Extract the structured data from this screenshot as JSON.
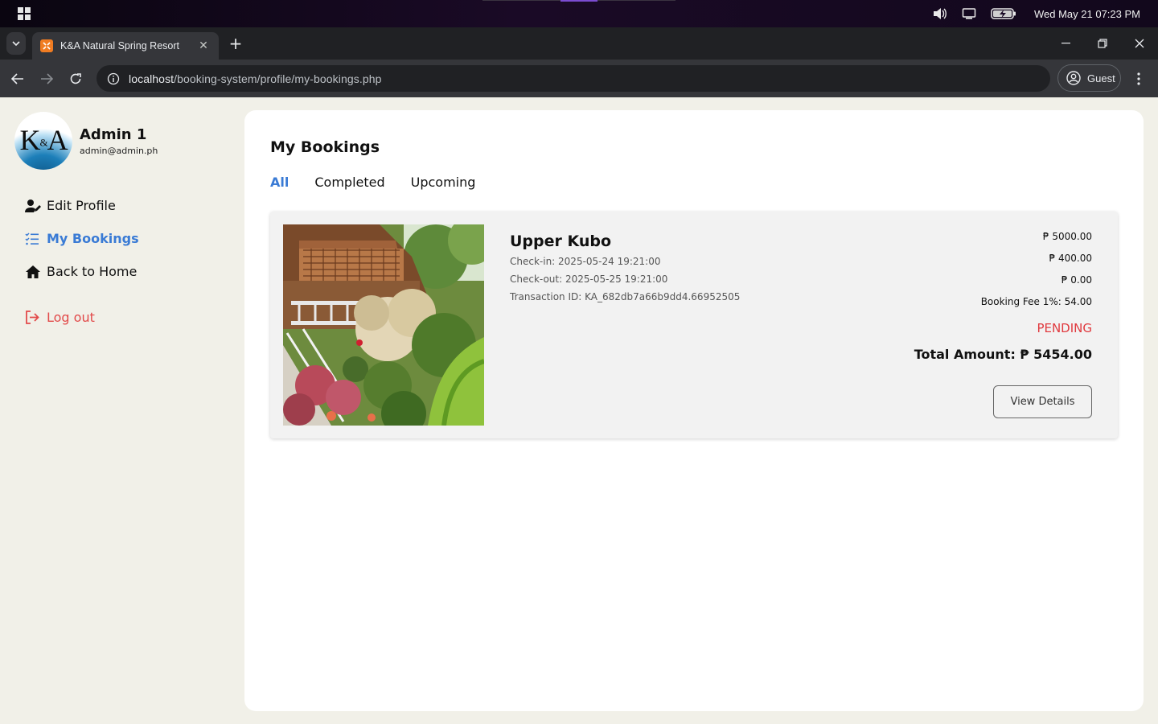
{
  "os": {
    "clock": "Wed May 21  07:23 PM",
    "icons": [
      "windows-logo-icon",
      "volume-icon",
      "display-icon",
      "battery-charging-icon"
    ]
  },
  "browser": {
    "tab_title": "K&A Natural Spring Resort",
    "url_host": "localhost",
    "url_path": "/booking-system/profile/my-bookings.php",
    "profile_label": "Guest"
  },
  "profile": {
    "logo_text": "K",
    "logo_amp": "&",
    "logo_text2": "A",
    "name": "Admin 1",
    "email": "admin@admin.ph"
  },
  "sidebar": {
    "items": [
      {
        "label": "Edit Profile",
        "icon": "user-edit-icon"
      },
      {
        "label": "My Bookings",
        "icon": "list-check-icon",
        "active": true
      },
      {
        "label": "Back to Home",
        "icon": "home-icon"
      }
    ],
    "logout": {
      "label": "Log out",
      "icon": "logout-icon"
    }
  },
  "main": {
    "title": "My Bookings",
    "tabs": [
      {
        "label": "All",
        "active": true
      },
      {
        "label": "Completed"
      },
      {
        "label": "Upcoming"
      }
    ]
  },
  "booking": {
    "room_name": "Upper Kubo",
    "check_in": "Check-in: 2025-05-24 19:21:00",
    "check_out": "Check-out: 2025-05-25 19:21:00",
    "transaction": "Transaction ID: KA_682db7a66b9dd4.66952505",
    "price_1": "₱ 5000.00",
    "price_2": "₱ 400.00",
    "price_3": "₱ 0.00",
    "booking_fee": "Booking Fee 1%: 54.00",
    "status": "PENDING",
    "total": "Total Amount: ₱ 5454.00",
    "view_details": "View Details"
  },
  "colors": {
    "accent": "#3a7bd5",
    "danger": "#e24a4a",
    "page_bg": "#f1f0e8"
  }
}
